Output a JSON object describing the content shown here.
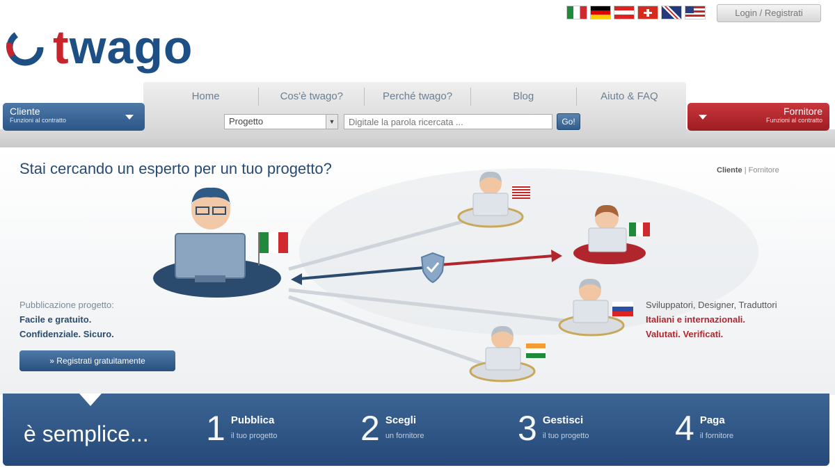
{
  "topbar": {
    "flags": [
      "italian-flag",
      "german-flag",
      "austrian-flag",
      "swiss-flag",
      "uk-flag",
      "us-flag"
    ],
    "login_label": "Login / Registrati"
  },
  "logo": {
    "text_t": "t",
    "text_rest": "wago"
  },
  "nav": {
    "items": [
      "Home",
      "Cos'è twago?",
      "Perché twago?",
      "Blog",
      "Aiuto & FAQ"
    ],
    "select_value": "Progetto",
    "search_placeholder": "Digitale la parola ricercata ...",
    "search_button": "Go!"
  },
  "cliente_button": {
    "title": "Cliente",
    "subtitle": "Funzioni al contratto"
  },
  "fornitore_button": {
    "title": "Fornitore",
    "subtitle": "Funzioni al contratto"
  },
  "hero": {
    "headline": "Stai cercando un esperto per un tuo progetto?",
    "switch_active": "Cliente",
    "switch_sep": " | ",
    "switch_other": "Fornitore",
    "left_line1": "Pubblicazione progetto:",
    "left_line2": "Facile e gratuito.",
    "left_line3": "Confidenziale. Sicuro.",
    "register_label": "» Registrati gratuitamente",
    "right_line1": "Sviluppatori, Designer, Traduttori",
    "right_line2": "Italiani e internazionali.",
    "right_line3": "Valutati. Verificati."
  },
  "steps_bar": {
    "intro": "è semplice...",
    "steps": [
      {
        "num": "1",
        "title": "Pubblica",
        "sub": "il tuo progetto"
      },
      {
        "num": "2",
        "title": "Scegli",
        "sub": "un fornitore"
      },
      {
        "num": "3",
        "title": "Gestisci",
        "sub": "il tuo progetto"
      },
      {
        "num": "4",
        "title": "Paga",
        "sub": "il fornitore"
      }
    ]
  },
  "colors": {
    "brand_blue": "#1e4f84",
    "brand_red": "#c7252b"
  }
}
